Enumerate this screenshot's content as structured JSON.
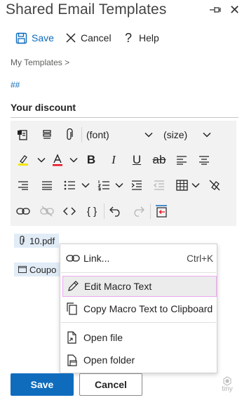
{
  "header": {
    "title": "Shared Email Templates",
    "pin_icon": "pin-icon",
    "close_icon": "close-icon"
  },
  "commands": {
    "save_label": "Save",
    "cancel_label": "Cancel",
    "help_label": "Help"
  },
  "breadcrumb": "My Templates >",
  "hash_link": "##",
  "template_title": "Your discount",
  "toolbar": {
    "font_select": "(font)",
    "size_select": "(size)"
  },
  "content": {
    "attachment_name": "10.pdf",
    "second_item": "Coupo"
  },
  "context_menu": {
    "items": [
      {
        "label": "Link...",
        "shortcut": "Ctrl+K",
        "icon": "link-icon"
      },
      {
        "label": "Edit Macro Text",
        "icon": "pencil-icon"
      },
      {
        "label": "Copy Macro Text to Clipboard",
        "icon": "copy-icon"
      },
      {
        "label": "Open file",
        "icon": "file-icon"
      },
      {
        "label": "Open folder",
        "icon": "folder-icon"
      }
    ]
  },
  "footer": {
    "save_label": "Save",
    "cancel_label": "Cancel",
    "brand": "tiny"
  },
  "colors": {
    "accent": "#0f6cbd",
    "highlight_yellow": "#f2e600",
    "font_color_red": "#e81123",
    "menu_highlight_border": "#f0a8f2"
  }
}
